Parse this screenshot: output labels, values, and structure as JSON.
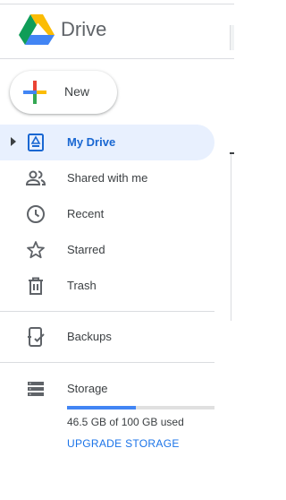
{
  "app": {
    "name": "Drive",
    "logo_icon": "google-drive-logo"
  },
  "new_button": {
    "label": "New",
    "icon": "plus-icon"
  },
  "nav": {
    "items": [
      {
        "label": "My Drive",
        "icon": "my-drive-icon",
        "active": true
      },
      {
        "label": "Shared with me",
        "icon": "shared-people-icon",
        "active": false
      },
      {
        "label": "Recent",
        "icon": "clock-icon",
        "active": false
      },
      {
        "label": "Starred",
        "icon": "star-icon",
        "active": false
      },
      {
        "label": "Trash",
        "icon": "trash-icon",
        "active": false
      }
    ],
    "secondary": [
      {
        "label": "Backups",
        "icon": "backup-device-icon"
      }
    ]
  },
  "storage": {
    "label": "Storage",
    "icon": "storage-icon",
    "usage_text": "46.5 GB of 100 GB used",
    "used_fraction": 0.465,
    "upgrade_label": "UPGRADE STORAGE"
  },
  "colors": {
    "accent_blue": "#1967d2",
    "active_bg": "#e8f0fe",
    "storage_fill": "#4285f4",
    "text": "#3c4043"
  }
}
